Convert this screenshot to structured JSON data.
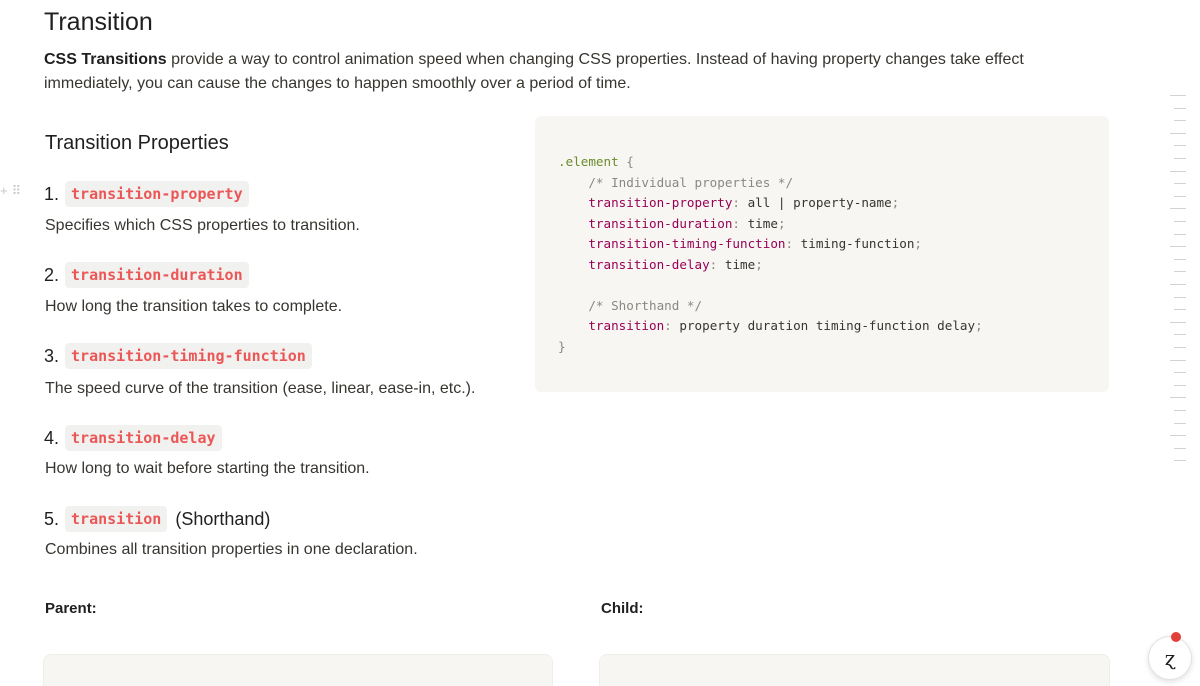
{
  "page": {
    "title": "Transition",
    "intro_bold": "CSS Transitions",
    "intro_rest": " provide a way to control animation speed when changing CSS properties. Instead of having property changes take effect immediately, you can cause the changes to happen smoothly over a period of time."
  },
  "section": {
    "heading": "Transition Properties",
    "items": [
      {
        "number": "1.",
        "code": "transition-property",
        "suffix": "",
        "description": "Specifies which CSS properties to transition."
      },
      {
        "number": "2.",
        "code": "transition-duration",
        "suffix": "",
        "description": "How long the transition takes to complete."
      },
      {
        "number": "3.",
        "code": "transition-timing-function",
        "suffix": "",
        "description": "The speed curve of the transition (ease, linear, ease-in, etc.)."
      },
      {
        "number": "4.",
        "code": "transition-delay",
        "suffix": "",
        "description": "How long to wait before starting the transition."
      },
      {
        "number": "5.",
        "code": "transition",
        "suffix": "(Shorthand)",
        "description": "Combines all transition properties in one declaration."
      }
    ]
  },
  "codeblock": {
    "selector": ".element",
    "open_brace": "{",
    "comment_individual": "/* Individual properties */",
    "lines": [
      {
        "prop": "transition-property",
        "value": "all | property-name"
      },
      {
        "prop": "transition-duration",
        "value": "time"
      },
      {
        "prop": "transition-timing-function",
        "value": "timing-function"
      },
      {
        "prop": "transition-delay",
        "value": "time"
      }
    ],
    "comment_shorthand": "/* Shorthand */",
    "shorthand": {
      "prop": "transition",
      "value": "property duration timing-function delay"
    },
    "close_brace": "}"
  },
  "demo": {
    "parent_label": "Parent:",
    "child_label": "Child:"
  },
  "icons": {
    "add_block": "plus-icon",
    "drag_handle": "drag-handle-icon",
    "help": "help-icon"
  },
  "colors": {
    "inline_code_text": "#eb5757",
    "inline_code_bg": "#f1f1ef",
    "codeblock_bg": "#f7f6f3",
    "css_property": "#990055",
    "css_selector": "#6a8d2c",
    "css_comment": "#8a8883"
  }
}
